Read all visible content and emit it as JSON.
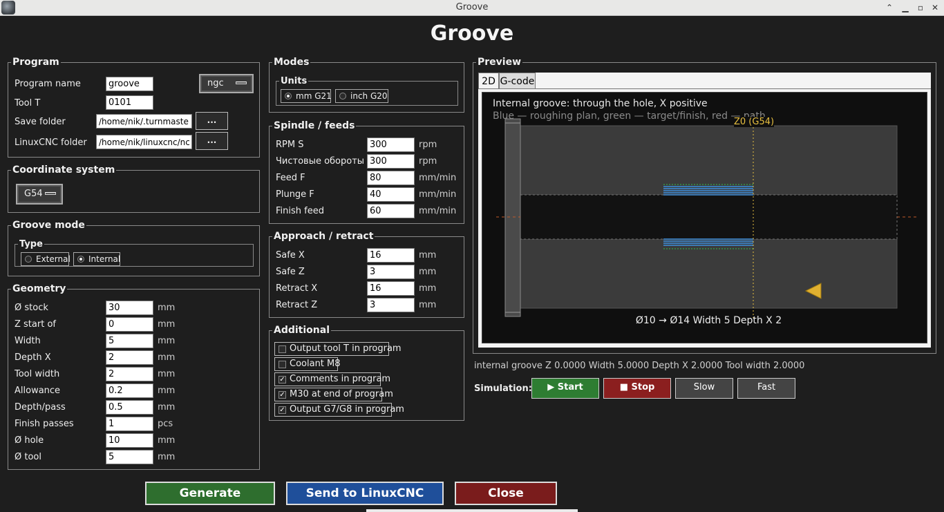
{
  "window": {
    "title": "Groove"
  },
  "main_title": "Groove",
  "program": {
    "legend": "Program",
    "name_label": "Program name",
    "name_value": "groove",
    "format_value": "ngc",
    "tool_label": "Tool T",
    "tool_value": "0101",
    "save_label": "Save folder",
    "save_value": "/home/nik/.turnmaster/ge",
    "linuxcnc_label": "LinuxCNC folder",
    "linuxcnc_value": "/home/nik/linuxcnc/nc_fil",
    "browse_label": "..."
  },
  "coord": {
    "legend": "Coordinate system",
    "value": "G54"
  },
  "groove_mode": {
    "legend": "Groove mode",
    "type_legend": "Type",
    "external": "External",
    "internal": "Internal",
    "selected": "Internal"
  },
  "geometry": {
    "legend": "Geometry",
    "rows": [
      {
        "label": "Ø stock",
        "value": "30",
        "unit": "mm"
      },
      {
        "label": "Z start of",
        "value": "0",
        "unit": "mm"
      },
      {
        "label": "Width",
        "value": "5",
        "unit": "mm"
      },
      {
        "label": "Depth X",
        "value": "2",
        "unit": "mm"
      },
      {
        "label": "Tool width",
        "value": "2",
        "unit": "mm"
      },
      {
        "label": "Allowance",
        "value": "0.2",
        "unit": "mm"
      },
      {
        "label": "Depth/pass",
        "value": "0.5",
        "unit": "mm"
      },
      {
        "label": "Finish passes",
        "value": "1",
        "unit": "pcs"
      },
      {
        "label": "Ø hole",
        "value": "10",
        "unit": "mm"
      },
      {
        "label": "Ø tool",
        "value": "5",
        "unit": "mm"
      }
    ]
  },
  "modes": {
    "legend": "Modes",
    "units_legend": "Units",
    "mm": "mm G21",
    "inch": "inch G20",
    "selected": "mm"
  },
  "spindle": {
    "legend": "Spindle / feeds",
    "rows": [
      {
        "label": "RPM S",
        "value": "300",
        "unit": "rpm"
      },
      {
        "label": "Чистовые обороты S",
        "value": "300",
        "unit": "rpm"
      },
      {
        "label": "Feed F",
        "value": "80",
        "unit": "mm/min"
      },
      {
        "label": "Plunge F",
        "value": "40",
        "unit": "mm/min"
      },
      {
        "label": "Finish feed",
        "value": "60",
        "unit": "mm/min"
      }
    ]
  },
  "approach": {
    "legend": "Approach / retract",
    "rows": [
      {
        "label": "Safe X",
        "value": "16",
        "unit": "mm"
      },
      {
        "label": "Safe Z",
        "value": "3",
        "unit": "mm"
      },
      {
        "label": "Retract X",
        "value": "16",
        "unit": "mm"
      },
      {
        "label": "Retract Z",
        "value": "3",
        "unit": "mm"
      }
    ]
  },
  "additional": {
    "legend": "Additional",
    "items": [
      {
        "label": "Output tool T in program",
        "checked": false
      },
      {
        "label": "Coolant M8",
        "checked": false
      },
      {
        "label": "Comments in program",
        "checked": true
      },
      {
        "label": "M30 at end of program",
        "checked": true
      },
      {
        "label": "Output G7/G8 in program",
        "checked": true
      }
    ]
  },
  "preview": {
    "legend": "Preview",
    "tabs": [
      "2D",
      "G-code"
    ],
    "active_tab": "2D",
    "line1": "Internal groove: through the hole, X positive",
    "line2": "Blue — roughing plan, green — target/finish, red — path",
    "z0_label": "Z0 (G54)",
    "dims": "Ø10 → Ø14   Width 5   Depth X 2",
    "colors": {
      "roughing": "#3d8fe0",
      "finish": "#2fbf4f",
      "path": "#e04040",
      "z0": "#e8c040",
      "tool": "#e0b030"
    }
  },
  "status": {
    "text": "internal groove   Z 0.0000   Width 5.0000   Depth X 2.0000   Tool width 2.0000"
  },
  "simulation": {
    "label": "Simulation:",
    "start": "▶ Start",
    "stop": "■ Stop",
    "slow": "Slow",
    "fast": "Fast"
  },
  "actions": {
    "generate": "Generate",
    "send": "Send to LinuxCNC",
    "close": "Close"
  }
}
